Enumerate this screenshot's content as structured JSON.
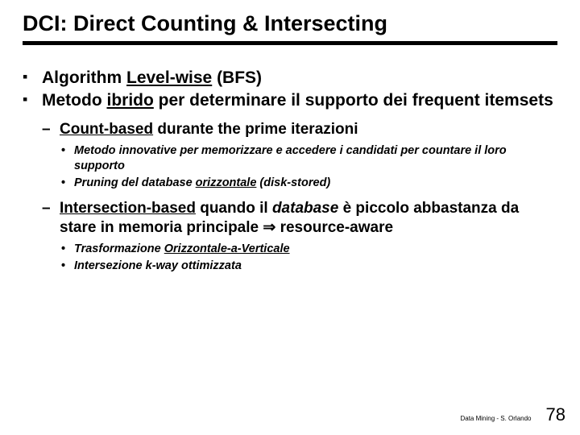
{
  "title": "DCI: Direct Counting & Intersecting",
  "b1": {
    "a_pre": "Algorithm ",
    "a_u": "Level-wise",
    "a_post": " (BFS)",
    "b_pre": "Metodo ",
    "b_u": "ibrido",
    "b_post": " per determinare il supporto dei frequent itemsets"
  },
  "b2": {
    "a_pre": "Count-based",
    "a_post": " durante the prime iterazioni",
    "b_pre": "Intersection-based",
    "b_mid1": " quando il ",
    "b_it": "database",
    "b_mid2": " è piccolo abbastanza da stare in memoria principale ",
    "b_arrow": "⇒",
    "b_post": " resource-aware"
  },
  "b3": {
    "a": "Metodo innovative per memorizzare e accedere i candidati per countare il loro supporto",
    "b_pre": "Pruning del database ",
    "b_u": "orizzontale",
    "b_post": " (disk-stored)",
    "c_pre": "Trasformazione ",
    "c_u": "Orizzontale-a-Verticale",
    "d": "Intersezione k-way ottimizzata"
  },
  "footer": {
    "credit": "Data Mining - S. Orlando",
    "page": "78"
  }
}
